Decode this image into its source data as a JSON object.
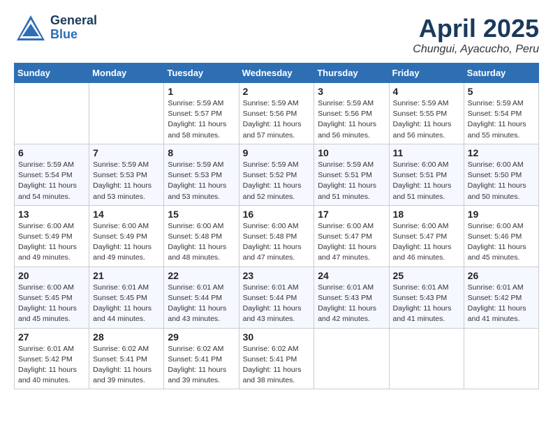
{
  "header": {
    "logo_general": "General",
    "logo_blue": "Blue",
    "title": "April 2025",
    "subtitle": "Chungui, Ayacucho, Peru"
  },
  "days_of_week": [
    "Sunday",
    "Monday",
    "Tuesday",
    "Wednesday",
    "Thursday",
    "Friday",
    "Saturday"
  ],
  "weeks": [
    [
      {
        "day": "",
        "info": ""
      },
      {
        "day": "",
        "info": ""
      },
      {
        "day": "1",
        "info": "Sunrise: 5:59 AM\nSunset: 5:57 PM\nDaylight: 11 hours and 58 minutes."
      },
      {
        "day": "2",
        "info": "Sunrise: 5:59 AM\nSunset: 5:56 PM\nDaylight: 11 hours and 57 minutes."
      },
      {
        "day": "3",
        "info": "Sunrise: 5:59 AM\nSunset: 5:56 PM\nDaylight: 11 hours and 56 minutes."
      },
      {
        "day": "4",
        "info": "Sunrise: 5:59 AM\nSunset: 5:55 PM\nDaylight: 11 hours and 56 minutes."
      },
      {
        "day": "5",
        "info": "Sunrise: 5:59 AM\nSunset: 5:54 PM\nDaylight: 11 hours and 55 minutes."
      }
    ],
    [
      {
        "day": "6",
        "info": "Sunrise: 5:59 AM\nSunset: 5:54 PM\nDaylight: 11 hours and 54 minutes."
      },
      {
        "day": "7",
        "info": "Sunrise: 5:59 AM\nSunset: 5:53 PM\nDaylight: 11 hours and 53 minutes."
      },
      {
        "day": "8",
        "info": "Sunrise: 5:59 AM\nSunset: 5:53 PM\nDaylight: 11 hours and 53 minutes."
      },
      {
        "day": "9",
        "info": "Sunrise: 5:59 AM\nSunset: 5:52 PM\nDaylight: 11 hours and 52 minutes."
      },
      {
        "day": "10",
        "info": "Sunrise: 5:59 AM\nSunset: 5:51 PM\nDaylight: 11 hours and 51 minutes."
      },
      {
        "day": "11",
        "info": "Sunrise: 6:00 AM\nSunset: 5:51 PM\nDaylight: 11 hours and 51 minutes."
      },
      {
        "day": "12",
        "info": "Sunrise: 6:00 AM\nSunset: 5:50 PM\nDaylight: 11 hours and 50 minutes."
      }
    ],
    [
      {
        "day": "13",
        "info": "Sunrise: 6:00 AM\nSunset: 5:49 PM\nDaylight: 11 hours and 49 minutes."
      },
      {
        "day": "14",
        "info": "Sunrise: 6:00 AM\nSunset: 5:49 PM\nDaylight: 11 hours and 49 minutes."
      },
      {
        "day": "15",
        "info": "Sunrise: 6:00 AM\nSunset: 5:48 PM\nDaylight: 11 hours and 48 minutes."
      },
      {
        "day": "16",
        "info": "Sunrise: 6:00 AM\nSunset: 5:48 PM\nDaylight: 11 hours and 47 minutes."
      },
      {
        "day": "17",
        "info": "Sunrise: 6:00 AM\nSunset: 5:47 PM\nDaylight: 11 hours and 47 minutes."
      },
      {
        "day": "18",
        "info": "Sunrise: 6:00 AM\nSunset: 5:47 PM\nDaylight: 11 hours and 46 minutes."
      },
      {
        "day": "19",
        "info": "Sunrise: 6:00 AM\nSunset: 5:46 PM\nDaylight: 11 hours and 45 minutes."
      }
    ],
    [
      {
        "day": "20",
        "info": "Sunrise: 6:00 AM\nSunset: 5:45 PM\nDaylight: 11 hours and 45 minutes."
      },
      {
        "day": "21",
        "info": "Sunrise: 6:01 AM\nSunset: 5:45 PM\nDaylight: 11 hours and 44 minutes."
      },
      {
        "day": "22",
        "info": "Sunrise: 6:01 AM\nSunset: 5:44 PM\nDaylight: 11 hours and 43 minutes."
      },
      {
        "day": "23",
        "info": "Sunrise: 6:01 AM\nSunset: 5:44 PM\nDaylight: 11 hours and 43 minutes."
      },
      {
        "day": "24",
        "info": "Sunrise: 6:01 AM\nSunset: 5:43 PM\nDaylight: 11 hours and 42 minutes."
      },
      {
        "day": "25",
        "info": "Sunrise: 6:01 AM\nSunset: 5:43 PM\nDaylight: 11 hours and 41 minutes."
      },
      {
        "day": "26",
        "info": "Sunrise: 6:01 AM\nSunset: 5:42 PM\nDaylight: 11 hours and 41 minutes."
      }
    ],
    [
      {
        "day": "27",
        "info": "Sunrise: 6:01 AM\nSunset: 5:42 PM\nDaylight: 11 hours and 40 minutes."
      },
      {
        "day": "28",
        "info": "Sunrise: 6:02 AM\nSunset: 5:41 PM\nDaylight: 11 hours and 39 minutes."
      },
      {
        "day": "29",
        "info": "Sunrise: 6:02 AM\nSunset: 5:41 PM\nDaylight: 11 hours and 39 minutes."
      },
      {
        "day": "30",
        "info": "Sunrise: 6:02 AM\nSunset: 5:41 PM\nDaylight: 11 hours and 38 minutes."
      },
      {
        "day": "",
        "info": ""
      },
      {
        "day": "",
        "info": ""
      },
      {
        "day": "",
        "info": ""
      }
    ]
  ]
}
